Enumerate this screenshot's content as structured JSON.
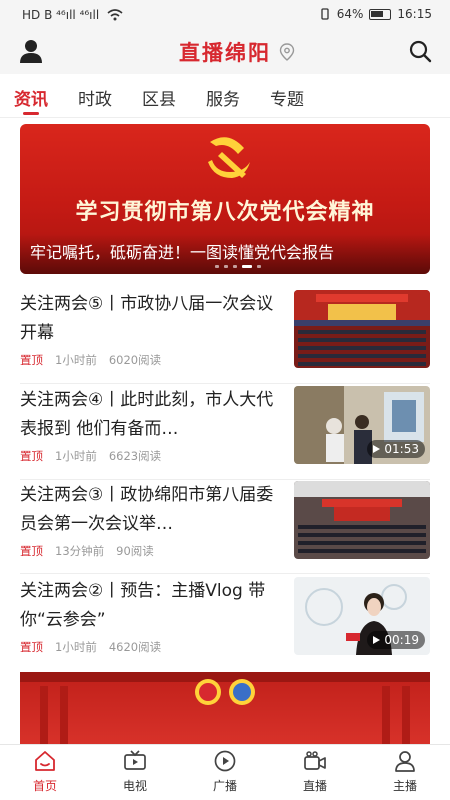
{
  "status_bar": {
    "left": "HD B ⁴⁶ıll ⁴⁶ıll",
    "battery": "64%",
    "time": "16:15"
  },
  "app": {
    "title": "直播绵阳",
    "accent_color": "#d7282f"
  },
  "tabs": [
    {
      "label": "资讯",
      "active": true
    },
    {
      "label": "时政",
      "active": false
    },
    {
      "label": "区县",
      "active": false
    },
    {
      "label": "服务",
      "active": false
    },
    {
      "label": "专题",
      "active": false
    }
  ],
  "banner": {
    "headline": "学习贯彻市第八次党代会精神",
    "caption": "牢记嘱托，砥砺奋进！一图读懂党代会报告"
  },
  "news": [
    {
      "title": "关注两会⑤丨市政协八届一次会议开幕",
      "pin": "置顶",
      "time": "1小时前",
      "reads": "6020阅读",
      "thumb_icon": "meeting-hall-image",
      "duration": ""
    },
    {
      "title": "关注两会④丨此时此刻，市人大代表报到 他们有备而…",
      "pin": "置顶",
      "time": "1小时前",
      "reads": "6623阅读",
      "thumb_icon": "video-thumbnail",
      "duration": "01:53"
    },
    {
      "title": "关注两会③丨政协绵阳市第八届委员会第一次会议举…",
      "pin": "置顶",
      "time": "13分钟前",
      "reads": "90阅读",
      "thumb_icon": "meeting-hall-image",
      "duration": ""
    },
    {
      "title": "关注两会②丨预告：主播Vlog 带你“云参会”",
      "pin": "置顶",
      "time": "1小时前",
      "reads": "4620阅读",
      "thumb_icon": "video-thumbnail",
      "duration": "00:19"
    }
  ],
  "bottom_nav": [
    {
      "label": "首页",
      "icon": "home-icon",
      "active": true
    },
    {
      "label": "电视",
      "icon": "tv-icon",
      "active": false
    },
    {
      "label": "广播",
      "icon": "radio-icon",
      "active": false
    },
    {
      "label": "直播",
      "icon": "live-camera-icon",
      "active": false
    },
    {
      "label": "主播",
      "icon": "anchor-icon",
      "active": false
    }
  ]
}
